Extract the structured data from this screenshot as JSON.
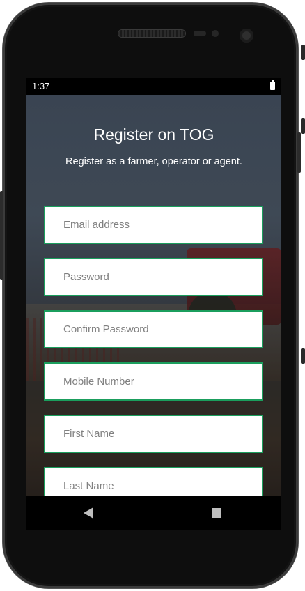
{
  "status_bar": {
    "time": "1:37",
    "battery_icon": "battery-full-icon"
  },
  "screen": {
    "title": "Register on TOG",
    "subtitle": "Register as a farmer, operator or agent."
  },
  "form": {
    "accent_color": "#1b9e5d",
    "fields": [
      {
        "placeholder": "Email address",
        "value": ""
      },
      {
        "placeholder": "Password",
        "value": ""
      },
      {
        "placeholder": "Confirm Password",
        "value": ""
      },
      {
        "placeholder": "Mobile Number",
        "value": ""
      },
      {
        "placeholder": "First Name",
        "value": ""
      },
      {
        "placeholder": "Last Name",
        "value": ""
      }
    ]
  },
  "nav_bar": {
    "back_icon": "back-triangle-icon",
    "recents_icon": "recents-square-icon"
  }
}
